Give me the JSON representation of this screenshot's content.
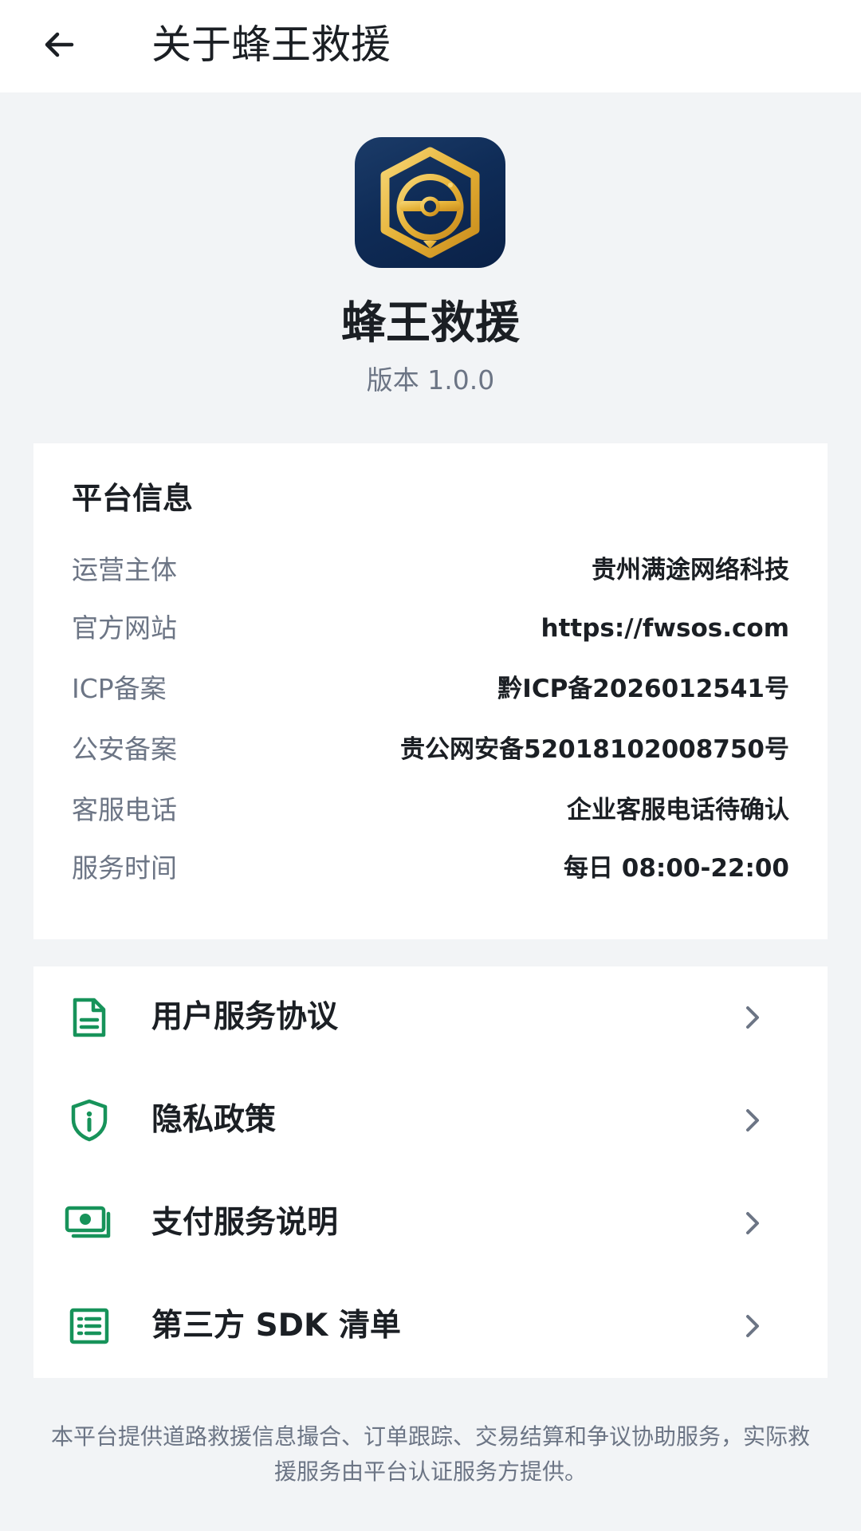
{
  "header": {
    "title": "关于蜂王救援",
    "back_icon": "arrow-left-icon"
  },
  "app": {
    "logo_icon": "bee-king-hexagon-logo",
    "name": "蜂王救援",
    "version": "版本 1.0.0"
  },
  "platform_info": {
    "title": "平台信息",
    "rows": [
      {
        "label": "运营主体",
        "value": "贵州满途网络科技"
      },
      {
        "label": "官方网站",
        "value": "https://fwsos.com"
      },
      {
        "label": "ICP备案",
        "value": "黔ICP备2026012541号"
      },
      {
        "label": "公安备案",
        "value": "贵公网安备52018102008750号"
      },
      {
        "label": "客服电话",
        "value": "企业客服电话待确认"
      },
      {
        "label": "服务时间",
        "value": "每日 08:00-22:00"
      }
    ]
  },
  "links": [
    {
      "label": "用户服务协议",
      "icon": "document-icon"
    },
    {
      "label": "隐私政策",
      "icon": "shield-info-icon"
    },
    {
      "label": "支付服务说明",
      "icon": "payment-cash-icon"
    },
    {
      "label": "第三方 SDK 清单",
      "icon": "list-icon"
    }
  ],
  "footer": {
    "note": "本平台提供道路救援信息撮合、订单跟踪、交易结算和争议协助服务，实际救援服务由平台认证服务方提供。"
  },
  "colors": {
    "accent_green": "#17935a",
    "logo_background": "#0f2c57",
    "logo_gold": "#e8b93a",
    "page_background": "#f2f4f6",
    "muted_text": "#6c7585",
    "primary_text": "#1b1f24",
    "chevron": "#6c7585"
  }
}
